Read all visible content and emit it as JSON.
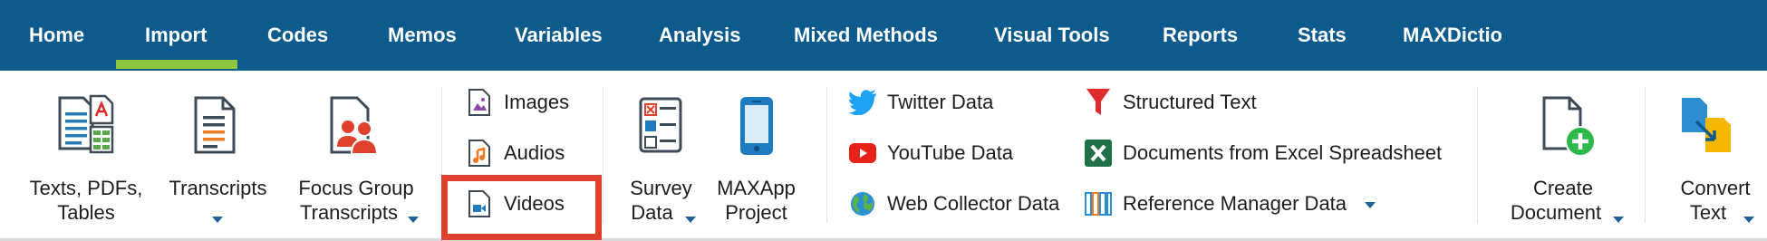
{
  "tabs": [
    {
      "label": "Home"
    },
    {
      "label": "Import"
    },
    {
      "label": "Codes"
    },
    {
      "label": "Memos"
    },
    {
      "label": "Variables"
    },
    {
      "label": "Analysis"
    },
    {
      "label": "Mixed Methods"
    },
    {
      "label": "Visual Tools"
    },
    {
      "label": "Reports"
    },
    {
      "label": "Stats"
    },
    {
      "label": "MAXDictio"
    }
  ],
  "active_tab": "Import",
  "colors": {
    "tabbar": "#0d5a8d",
    "active_underline": "#8dc63f",
    "highlight": "#e0412c",
    "dropdown_arrow": "#1e5f9c"
  },
  "ribbon": {
    "texts_pdfs": {
      "line1": "Texts, PDFs,",
      "line2": "Tables"
    },
    "transcripts": {
      "line1": "Transcripts"
    },
    "focus_group": {
      "line1": "Focus Group",
      "line2": "Transcripts"
    },
    "images": "Images",
    "audios": "Audios",
    "videos": "Videos",
    "survey": {
      "line1": "Survey",
      "line2": "Data"
    },
    "maxapp": {
      "line1": "MAXApp",
      "line2": "Project"
    },
    "twitter": "Twitter Data",
    "youtube": "YouTube Data",
    "web_collector": "Web Collector Data",
    "structured_text": "Structured Text",
    "excel_docs": "Documents from Excel Spreadsheet",
    "reference_manager": "Reference Manager Data",
    "create_document": {
      "line1": "Create",
      "line2": "Document"
    },
    "convert_text": {
      "line1": "Convert",
      "line2": "Text"
    }
  }
}
